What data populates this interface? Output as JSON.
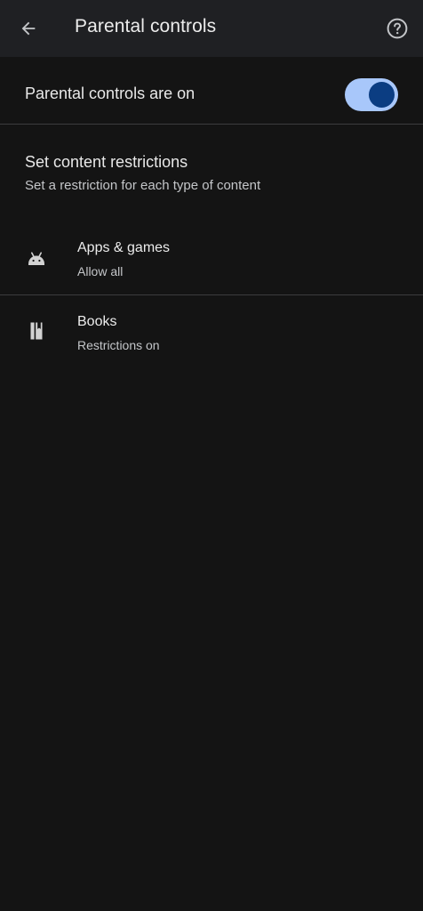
{
  "app_bar": {
    "title": "Parental controls",
    "back_icon": "arrow-back-icon",
    "help_icon": "help-circle-icon"
  },
  "master_switch": {
    "label": "Parental controls are on",
    "state": "on"
  },
  "content_restrictions": {
    "title": "Set content restrictions",
    "subtitle": "Set a restriction for each type of content",
    "items": [
      {
        "icon": "android-icon",
        "title": "Apps & games",
        "subtitle": "Allow all"
      },
      {
        "icon": "book-icon",
        "title": "Books",
        "subtitle": "Restrictions on"
      }
    ]
  },
  "colors": {
    "background": "#141414",
    "app_bar": "#1f2023",
    "toggle_track": "#a8c7fa",
    "toggle_knob": "#0b3d82"
  }
}
